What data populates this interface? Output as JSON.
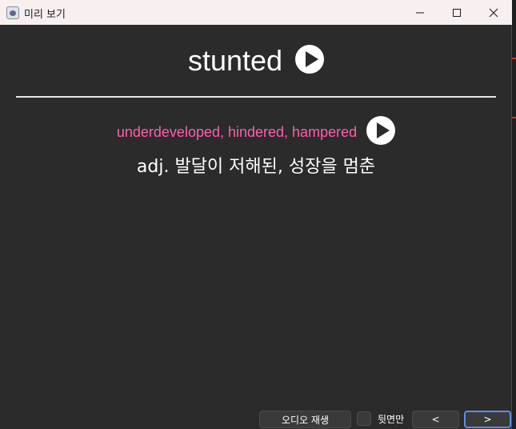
{
  "window": {
    "title": "미리 보기"
  },
  "card": {
    "word": "stunted",
    "synonyms": "underdeveloped, hindered, hampered",
    "meaning": "adj. 발달이 저해된, 성장을 멈춘"
  },
  "controls": {
    "play_audio_label": "오디오 재생",
    "back_only_label": "뒷면만",
    "back_only_checked": false,
    "prev_label": "<",
    "next_label": ">"
  },
  "icons": {
    "app": "app-icon",
    "minimize": "minimize-icon",
    "maximize": "maximize-icon",
    "close": "close-icon",
    "play": "play-icon"
  },
  "colors": {
    "background": "#2b2b2b",
    "titlebar": "#f7eff0",
    "synonyms": "#ff5fa9",
    "accent_focus": "#5a8fe8"
  }
}
